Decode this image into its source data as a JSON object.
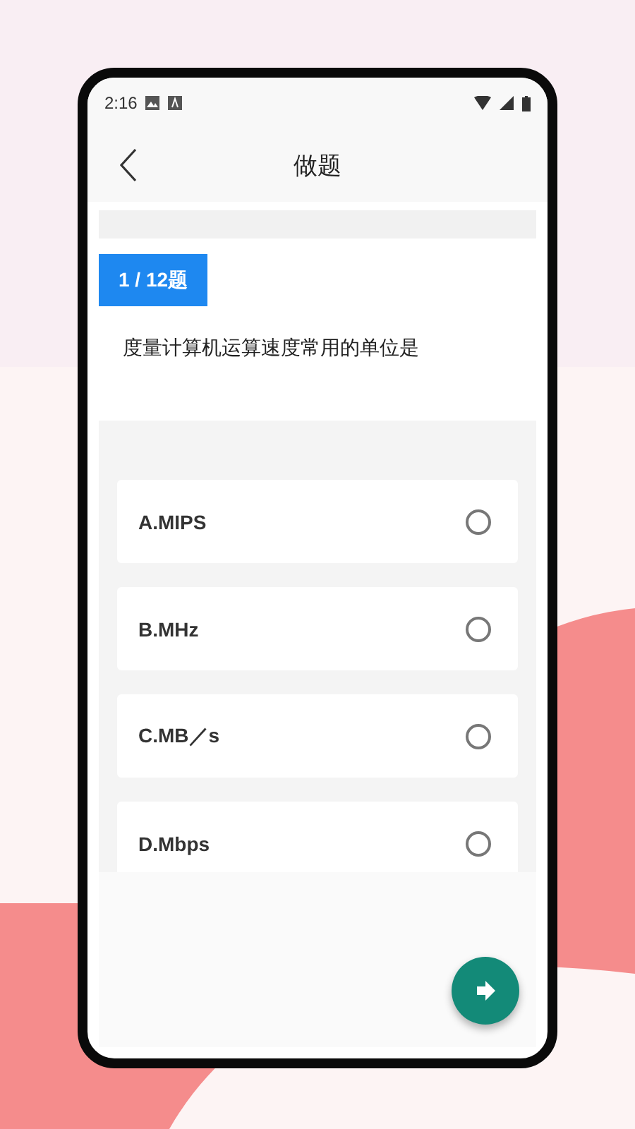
{
  "status_bar": {
    "time": "2:16"
  },
  "header": {
    "title": "做题"
  },
  "question": {
    "counter": "1 / 12题",
    "text": "度量计算机运算速度常用的单位是"
  },
  "options": [
    {
      "label": "A.MIPS",
      "selected": false
    },
    {
      "label": "B.MHz",
      "selected": false
    },
    {
      "label": "C.MB／s",
      "selected": false
    },
    {
      "label": "D.Mbps",
      "selected": false
    }
  ]
}
